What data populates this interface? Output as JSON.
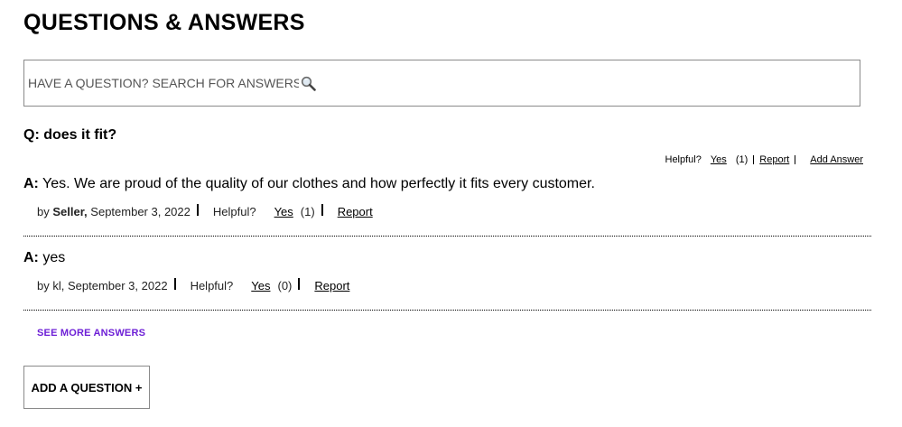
{
  "section_title": "QUESTIONS & ANSWERS",
  "search": {
    "placeholder": "HAVE A QUESTION? SEARCH FOR ANSWERS...",
    "icon": "magnifier-icon"
  },
  "question": {
    "prefix": "Q:",
    "text": "does it fit?",
    "helpful_label": "Helpful?",
    "yes_label": "Yes",
    "yes_count": "(1)",
    "report_label": "Report",
    "add_answer_label": "Add Answer"
  },
  "answers": [
    {
      "prefix": "A:",
      "text": "Yes. We are proud of the quality of our clothes and how perfectly it fits every customer.",
      "by_label": "by",
      "author": "Seller,",
      "date": "September 3, 2022",
      "helpful_label": "Helpful?",
      "yes_label": "Yes",
      "yes_count": "(1)",
      "report_label": "Report"
    },
    {
      "prefix": "A:",
      "text": "yes",
      "by_label": "by",
      "author": "kl,",
      "date": "September 3, 2022",
      "helpful_label": "Helpful?",
      "yes_label": "Yes",
      "yes_count": "(0)",
      "report_label": "Report"
    }
  ],
  "see_more_label": "SEE MORE ANSWERS",
  "add_question_label": "ADD A QUESTION +",
  "colors": {
    "accent": "#6d1fd6",
    "border": "#8a8a8a",
    "text": "#000000"
  }
}
